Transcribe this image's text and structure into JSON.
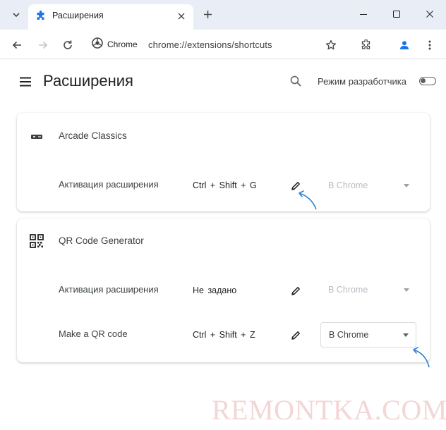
{
  "window": {
    "tab_title": "Расширения"
  },
  "toolbar": {
    "site_chip_label": "Chrome",
    "url": "chrome://extensions/shortcuts"
  },
  "page": {
    "title": "Расширения",
    "dev_mode_label": "Режим разработчика",
    "dev_mode_on": false
  },
  "extensions": [
    {
      "name": "Arcade Classics",
      "commands": [
        {
          "label": "Активация расширения",
          "shortcut": "Ctrl + Shift + G",
          "scope": "В Chrome",
          "scope_enabled": false
        }
      ]
    },
    {
      "name": "QR Code Generator",
      "commands": [
        {
          "label": "Активация расширения",
          "shortcut": "Не задано",
          "scope": "В Chrome",
          "scope_enabled": false
        },
        {
          "label": "Make a QR code",
          "shortcut": "Ctrl + Shift + Z",
          "scope": "В Chrome",
          "scope_enabled": true
        }
      ]
    }
  ],
  "watermark": "REMONTKA.COM",
  "colors": {
    "titlebar": "#e9eef6",
    "accent_blue": "#1a73e8",
    "annotation_arrow": "#2f80d1",
    "profile_blue": "#1a73e8"
  }
}
